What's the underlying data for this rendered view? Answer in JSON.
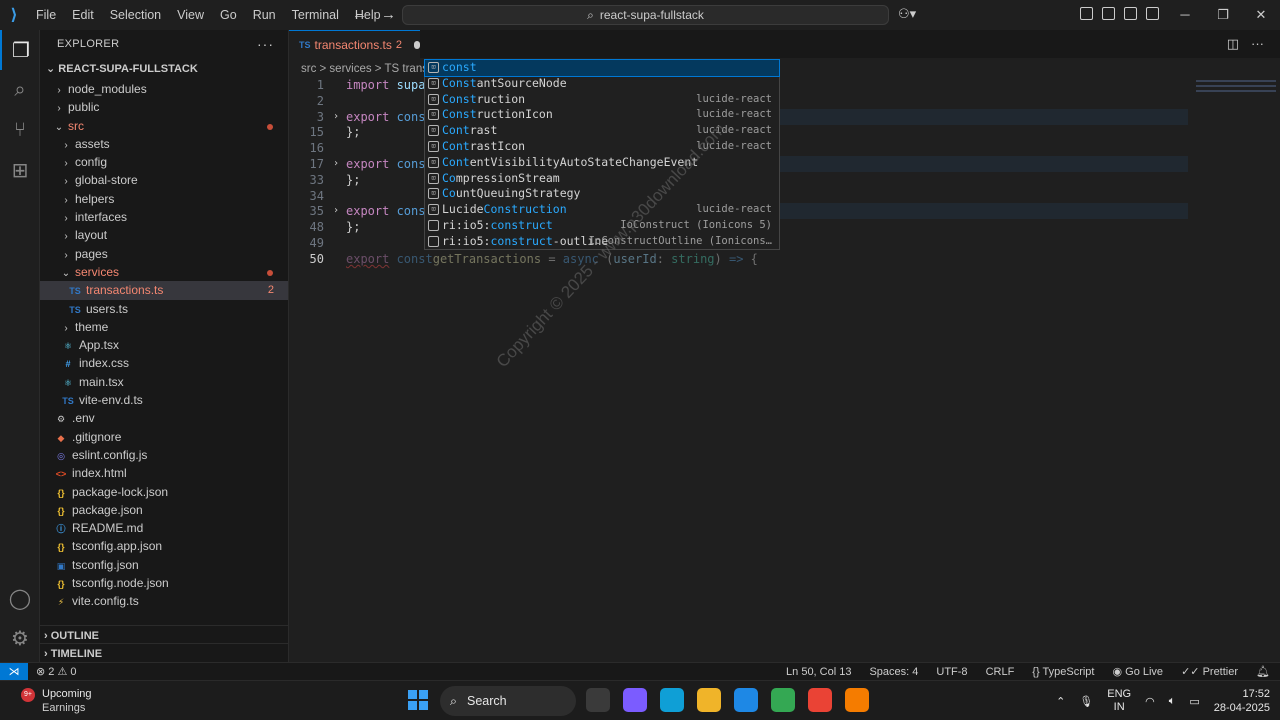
{
  "window": {
    "menu": [
      "File",
      "Edit",
      "Selection",
      "View",
      "Go",
      "Run",
      "Terminal",
      "Help"
    ],
    "search_text": "react-supa-fullstack",
    "copilot_label": "⚇▾"
  },
  "explorer": {
    "title": "EXPLORER",
    "project": "REACT-SUPA-FULLSTACK",
    "tree": [
      {
        "label": "node_modules",
        "type": "folder",
        "depth": 1,
        "open": false
      },
      {
        "label": "public",
        "type": "folder",
        "depth": 1,
        "open": false
      },
      {
        "label": "src",
        "type": "folder",
        "depth": 1,
        "open": true,
        "err": true,
        "dot": true
      },
      {
        "label": "assets",
        "type": "folder",
        "depth": 2,
        "open": false
      },
      {
        "label": "config",
        "type": "folder",
        "depth": 2,
        "open": false
      },
      {
        "label": "global-store",
        "type": "folder",
        "depth": 2,
        "open": false
      },
      {
        "label": "helpers",
        "type": "folder",
        "depth": 2,
        "open": false
      },
      {
        "label": "interfaces",
        "type": "folder",
        "depth": 2,
        "open": false
      },
      {
        "label": "layout",
        "type": "folder",
        "depth": 2,
        "open": false
      },
      {
        "label": "pages",
        "type": "folder",
        "depth": 2,
        "open": false
      },
      {
        "label": "services",
        "type": "folder",
        "depth": 2,
        "open": true,
        "err": true,
        "dot": true
      },
      {
        "label": "transactions.ts",
        "type": "ts",
        "depth": 3,
        "err": true,
        "selected": true,
        "badge": "2"
      },
      {
        "label": "users.ts",
        "type": "ts",
        "depth": 3
      },
      {
        "label": "theme",
        "type": "folder",
        "depth": 2,
        "open": false
      },
      {
        "label": "App.tsx",
        "type": "react",
        "depth": 2
      },
      {
        "label": "index.css",
        "type": "css",
        "depth": 2
      },
      {
        "label": "main.tsx",
        "type": "react",
        "depth": 2
      },
      {
        "label": "vite-env.d.ts",
        "type": "ts",
        "depth": 2
      },
      {
        "label": ".env",
        "type": "gear",
        "depth": 1
      },
      {
        "label": ".gitignore",
        "type": "git",
        "depth": 1
      },
      {
        "label": "eslint.config.js",
        "type": "eslint",
        "depth": 1
      },
      {
        "label": "index.html",
        "type": "html",
        "depth": 1
      },
      {
        "label": "package-lock.json",
        "type": "json",
        "depth": 1
      },
      {
        "label": "package.json",
        "type": "json",
        "depth": 1
      },
      {
        "label": "README.md",
        "type": "info",
        "depth": 1
      },
      {
        "label": "tsconfig.app.json",
        "type": "json",
        "depth": 1
      },
      {
        "label": "tsconfig.json",
        "type": "tsconf",
        "depth": 1
      },
      {
        "label": "tsconfig.node.json",
        "type": "json",
        "depth": 1
      },
      {
        "label": "vite.config.ts",
        "type": "vite",
        "depth": 1
      }
    ],
    "outline_label": "OUTLINE",
    "timeline_label": "TIMELINE"
  },
  "editor": {
    "tab": {
      "icon": "TS",
      "name": "transactions.ts",
      "problems": "2"
    },
    "breadcrumbs": "src  >  services  >  TS  trans",
    "lines": [
      {
        "num": "1",
        "fold": false,
        "tokens": [
          {
            "t": "import",
            "c": "kwc"
          },
          {
            "t": " supab",
            "c": "id"
          }
        ]
      },
      {
        "num": "2",
        "fold": false,
        "tokens": []
      },
      {
        "num": "3",
        "fold": true,
        "highlight": true,
        "tokens": [
          {
            "t": "export",
            "c": "kwc"
          },
          {
            "t": " const",
            "c": "kw"
          }
        ]
      },
      {
        "num": "15",
        "fold": false,
        "tokens": [
          {
            "t": "};",
            "c": "pn"
          }
        ]
      },
      {
        "num": "16",
        "fold": false,
        "tokens": []
      },
      {
        "num": "17",
        "fold": true,
        "highlight": true,
        "tokens": [
          {
            "t": "export",
            "c": "kwc"
          },
          {
            "t": " const",
            "c": "kw"
          }
        ]
      },
      {
        "num": "33",
        "fold": false,
        "tokens": [
          {
            "t": "};",
            "c": "pn"
          }
        ]
      },
      {
        "num": "34",
        "fold": false,
        "tokens": []
      },
      {
        "num": "35",
        "fold": true,
        "highlight": true,
        "tokens": [
          {
            "t": "export",
            "c": "kwc"
          },
          {
            "t": " const",
            "c": "kw"
          }
        ]
      },
      {
        "num": "48",
        "fold": false,
        "tokens": [
          {
            "t": "};",
            "c": "pn"
          }
        ]
      },
      {
        "num": "49",
        "fold": false,
        "tokens": []
      },
      {
        "num": "50",
        "fold": false,
        "current": true,
        "tokens": [
          {
            "t": "export",
            "c": "kwc squig dimtxt"
          },
          {
            "t": " const",
            "c": "kw dimtxt"
          },
          {
            "t": "getTransactions",
            "c": "fn dimtxt"
          },
          {
            "t": " = ",
            "c": "pn dimtxt"
          },
          {
            "t": "async",
            "c": "kw dimtxt"
          },
          {
            "t": " (",
            "c": "pn dimtxt"
          },
          {
            "t": "userId",
            "c": "id dimtxt"
          },
          {
            "t": ": ",
            "c": "pn dimtxt"
          },
          {
            "t": "string",
            "c": "ty dimtxt"
          },
          {
            "t": ") ",
            "c": "pn dimtxt"
          },
          {
            "t": "=>",
            "c": "kw dimtxt"
          },
          {
            "t": " {",
            "c": "pn dimtxt"
          }
        ]
      }
    ]
  },
  "suggestions": [
    {
      "pre": "",
      "match": "const",
      "post": "",
      "detail": "",
      "icon": "kw",
      "focused": true
    },
    {
      "pre": "",
      "match": "Const",
      "post": "antSourceNode",
      "detail": "",
      "icon": "var"
    },
    {
      "pre": "",
      "match": "Const",
      "post": "ruction",
      "detail": "lucide-react",
      "icon": "var"
    },
    {
      "pre": "",
      "match": "Const",
      "post": "ructionIcon",
      "detail": "lucide-react",
      "icon": "var"
    },
    {
      "pre": "",
      "match": "Cont",
      "post": "rast",
      "detail": "lucide-react",
      "icon": "var"
    },
    {
      "pre": "",
      "match": "Cont",
      "post": "rastIcon",
      "detail": "lucide-react",
      "icon": "var"
    },
    {
      "pre": "",
      "match": "Cont",
      "post": "entVisibilityAutoStateChangeEvent",
      "detail": "",
      "icon": "var"
    },
    {
      "pre": "",
      "match": "Co",
      "post": "mpressionStream",
      "detail": "",
      "icon": "var"
    },
    {
      "pre": "",
      "match": "Co",
      "post": "untQueuingStrategy",
      "detail": "",
      "icon": "var"
    },
    {
      "pre": "Lucide",
      "match": "Construction",
      "post": "",
      "detail": "lucide-react",
      "icon": "var"
    },
    {
      "pre": "ri:io5:",
      "match": "construct",
      "post": "",
      "detail": "IoConstruct (Ionicons 5)",
      "icon": "sq"
    },
    {
      "pre": "ri:io5:",
      "match": "construct",
      "post": "-outline",
      "detail": "IoConstructOutline (Ionicons…",
      "icon": "sq"
    }
  ],
  "watermark": "Copyright © 2025 - www.p30download.com",
  "statusbar": {
    "problems": "⊗ 2 ⚠ 0",
    "position": "Ln 50, Col 13",
    "spaces": "Spaces: 4",
    "encoding": "UTF-8",
    "eol": "CRLF",
    "language": "TypeScript",
    "golive": "Go Live",
    "prettier": "Prettier"
  },
  "taskbar": {
    "weather_badge": "9+",
    "weather_line1": "Upcoming",
    "weather_line2": "Earnings",
    "search_label": "Search",
    "lang1": "ENG",
    "lang2": "IN",
    "time": "17:52",
    "date": "28-04-2025",
    "app_colors": [
      "#3a3a3a",
      "#7b5cff",
      "#0f9fd6",
      "#f0b429",
      "#1e88e5",
      "#34a853",
      "#ea4335",
      "#f57c00"
    ]
  },
  "colors": {
    "accent": "#0078d4",
    "error": "#f48771"
  }
}
